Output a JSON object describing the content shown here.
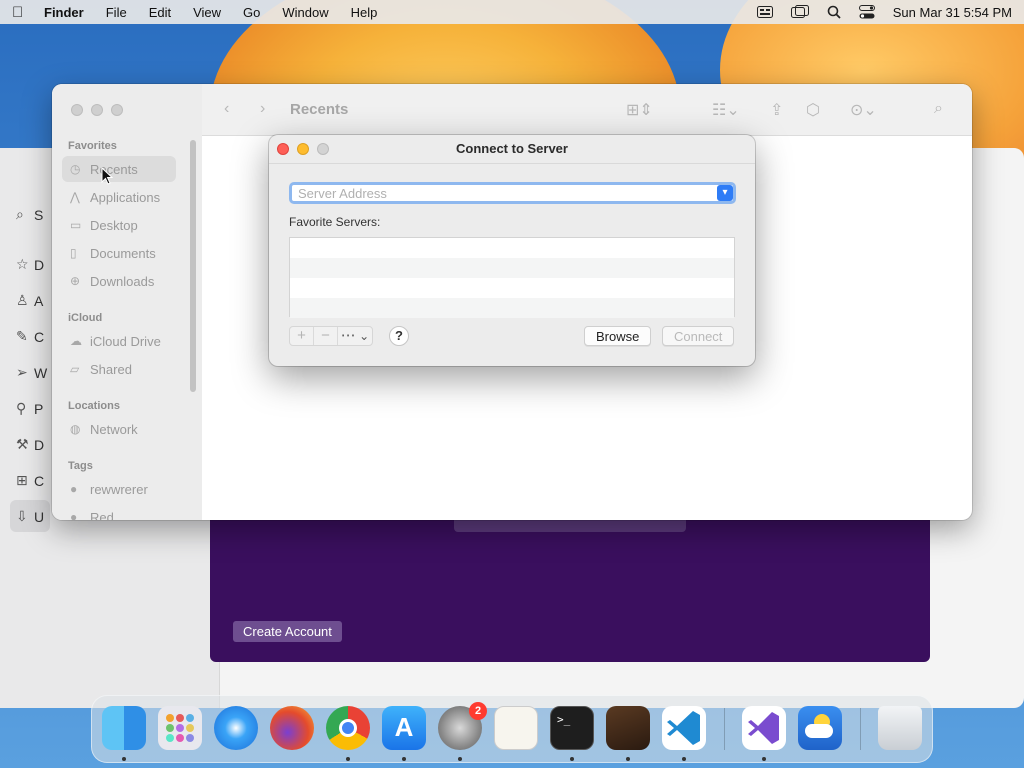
{
  "menubar": {
    "app_name": "Finder",
    "items": [
      "File",
      "Edit",
      "View",
      "Go",
      "Window",
      "Help"
    ],
    "clock": "Sun Mar 31  5:54 PM"
  },
  "back_window": {
    "sidebar_initials": [
      "S",
      "D",
      "A",
      "C",
      "W",
      "P",
      "D",
      "C",
      "U"
    ],
    "create_account": "Create Account"
  },
  "finder": {
    "title": "Recents",
    "sections": {
      "favorites": "Favorites",
      "icloud": "iCloud",
      "locations": "Locations",
      "tags": "Tags"
    },
    "favorites": [
      "Recents",
      "Applications",
      "Desktop",
      "Documents",
      "Downloads"
    ],
    "icloud_items": [
      "iCloud Drive",
      "Shared"
    ],
    "locations_items": [
      "Network"
    ],
    "tags_items": [
      "rewwrerer",
      "Red"
    ]
  },
  "dialog": {
    "title": "Connect to Server",
    "address_placeholder": "Server Address",
    "address_value": "",
    "favorites_label": "Favorite Servers:",
    "add_symbol": "+",
    "remove_symbol": "−",
    "more_symbol": "⋯",
    "help_symbol": "?",
    "browse_label": "Browse",
    "connect_label": "Connect"
  },
  "dock": {
    "settings_badge": "2"
  },
  "colors": {
    "accent_blue": "#2e7cf6",
    "close_red": "#fe5f57",
    "minimize_yellow": "#febc2e",
    "purple_panel": "#3a0f5e"
  }
}
